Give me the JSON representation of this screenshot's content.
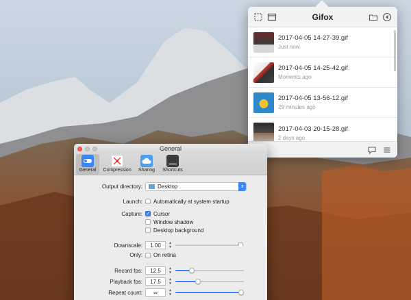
{
  "gifox": {
    "title": "Gifox",
    "items": [
      {
        "name": "2017-04-05 14-27-39.gif",
        "time": "Just now"
      },
      {
        "name": "2017-04-05 14-25-42.gif",
        "time": "Moments ago"
      },
      {
        "name": "2017-04-05 13-56-12.gif",
        "time": "29 minutes ago"
      },
      {
        "name": "2017-04-03 20-15-28.gif",
        "time": "2 days ago"
      }
    ]
  },
  "prefs": {
    "title": "General",
    "tabs": [
      {
        "label": "General",
        "icon": "toggle-icon",
        "active": true
      },
      {
        "label": "Compression",
        "icon": "compression-icon"
      },
      {
        "label": "Sharing",
        "icon": "cloud-icon"
      },
      {
        "label": "Shortcuts",
        "icon": "keyboard-icon"
      }
    ],
    "output_directory": {
      "label": "Output directory:",
      "value": "Desktop"
    },
    "launch": {
      "label": "Launch:",
      "option": "Automatically at system startup",
      "checked": false
    },
    "capture": {
      "label": "Capture:",
      "options": [
        {
          "label": "Cursor",
          "checked": true
        },
        {
          "label": "Window shadow",
          "checked": false
        },
        {
          "label": "Desktop background",
          "checked": false
        }
      ]
    },
    "downscale": {
      "label": "Downscale:",
      "value": "1.00",
      "level": 1.0
    },
    "only": {
      "label": "Only:",
      "option": "On retina",
      "checked": false
    },
    "record_fps": {
      "label": "Record fps:",
      "value": "12.5",
      "level": 0.22
    },
    "playback_fps": {
      "label": "Playback fps:",
      "value": "17.5",
      "level": 0.32
    },
    "repeat_count": {
      "label": "Repeat count:",
      "value": "∞",
      "level": 1.0
    }
  },
  "colors": {
    "accent": "#3b86f6",
    "close": "#fc605b"
  }
}
